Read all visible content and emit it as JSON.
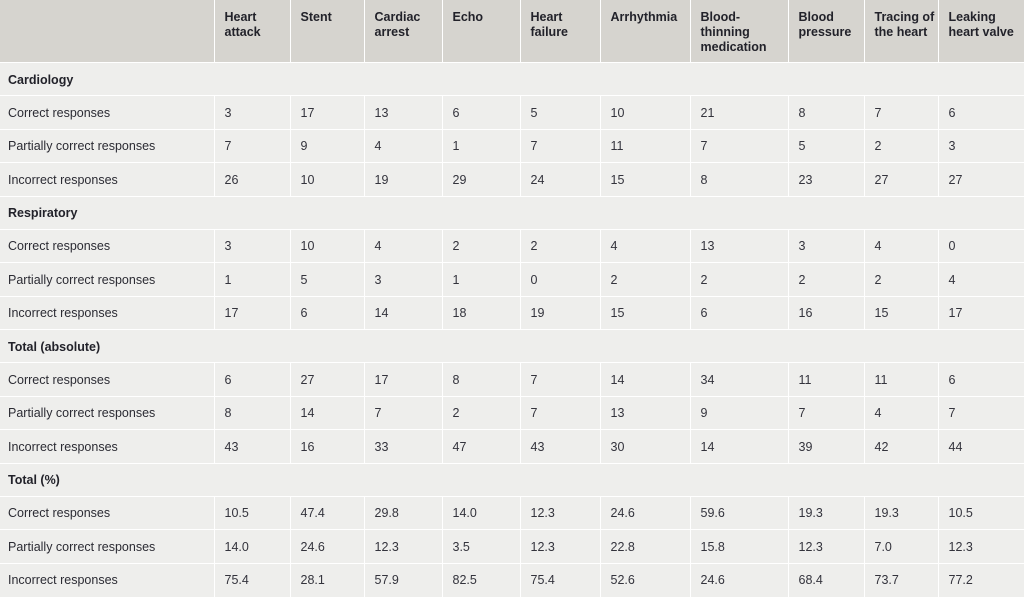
{
  "table": {
    "corner_label": "",
    "columns": [
      "Heart attack",
      "Stent",
      "Cardiac arrest",
      "Echo",
      "Heart failure",
      "Arrhythmia",
      "Blood-thinning medication",
      "Blood pressure",
      "Tracing of the heart",
      "Leaking heart valve"
    ],
    "sections": [
      {
        "title": "Cardiology",
        "rows": [
          {
            "label": "Correct responses",
            "values": [
              "3",
              "17",
              "13",
              "6",
              "5",
              "10",
              "21",
              "8",
              "7",
              "6"
            ]
          },
          {
            "label": "Partially correct responses",
            "values": [
              "7",
              "9",
              "4",
              "1",
              "7",
              "11",
              "7",
              "5",
              "2",
              "3"
            ]
          },
          {
            "label": "Incorrect responses",
            "values": [
              "26",
              "10",
              "19",
              "29",
              "24",
              "15",
              "8",
              "23",
              "27",
              "27"
            ]
          }
        ]
      },
      {
        "title": "Respiratory",
        "rows": [
          {
            "label": "Correct responses",
            "values": [
              "3",
              "10",
              "4",
              "2",
              "2",
              "4",
              "13",
              "3",
              "4",
              "0"
            ]
          },
          {
            "label": "Partially correct responses",
            "values": [
              "1",
              "5",
              "3",
              "1",
              "0",
              "2",
              "2",
              "2",
              "2",
              "4"
            ]
          },
          {
            "label": "Incorrect responses",
            "values": [
              "17",
              "6",
              "14",
              "18",
              "19",
              "15",
              "6",
              "16",
              "15",
              "17"
            ]
          }
        ]
      },
      {
        "title": "Total (absolute)",
        "rows": [
          {
            "label": "Correct responses",
            "values": [
              "6",
              "27",
              "17",
              "8",
              "7",
              "14",
              "34",
              "11",
              "11",
              "6"
            ]
          },
          {
            "label": "Partially correct responses",
            "values": [
              "8",
              "14",
              "7",
              "2",
              "7",
              "13",
              "9",
              "7",
              "4",
              "7"
            ]
          },
          {
            "label": "Incorrect responses",
            "values": [
              "43",
              "16",
              "33",
              "47",
              "43",
              "30",
              "14",
              "39",
              "42",
              "44"
            ]
          }
        ]
      },
      {
        "title": "Total (%)",
        "rows": [
          {
            "label": "Correct responses",
            "values": [
              "10.5",
              "47.4",
              "29.8",
              "14.0",
              "12.3",
              "24.6",
              "59.6",
              "19.3",
              "19.3",
              "10.5"
            ]
          },
          {
            "label": "Partially correct responses",
            "values": [
              "14.0",
              "24.6",
              "12.3",
              "3.5",
              "12.3",
              "22.8",
              "15.8",
              "12.3",
              "7.0",
              "12.3"
            ]
          },
          {
            "label": "Incorrect responses",
            "values": [
              "75.4",
              "28.1",
              "57.9",
              "82.5",
              "75.4",
              "52.6",
              "24.6",
              "68.4",
              "73.7",
              "77.2"
            ]
          }
        ]
      }
    ]
  },
  "colors": {
    "header_background": "#d6d4cf",
    "body_background": "#eeeeec",
    "grid_line": "#ffffff",
    "text": "#2b2b33"
  },
  "chart_data": {
    "type": "table",
    "title": "",
    "categories": [
      "Heart attack",
      "Stent",
      "Cardiac arrest",
      "Echo",
      "Heart failure",
      "Arrhythmia",
      "Blood-thinning medication",
      "Blood pressure",
      "Tracing of the heart",
      "Leaking heart valve"
    ],
    "series": [
      {
        "name": "Cardiology — Correct responses",
        "values": [
          3,
          17,
          13,
          6,
          5,
          10,
          21,
          8,
          7,
          6
        ]
      },
      {
        "name": "Cardiology — Partially correct responses",
        "values": [
          7,
          9,
          4,
          1,
          7,
          11,
          7,
          5,
          2,
          3
        ]
      },
      {
        "name": "Cardiology — Incorrect responses",
        "values": [
          26,
          10,
          19,
          29,
          24,
          15,
          8,
          23,
          27,
          27
        ]
      },
      {
        "name": "Respiratory — Correct responses",
        "values": [
          3,
          10,
          4,
          2,
          2,
          4,
          13,
          3,
          4,
          0
        ]
      },
      {
        "name": "Respiratory — Partially correct responses",
        "values": [
          1,
          5,
          3,
          1,
          0,
          2,
          2,
          2,
          2,
          4
        ]
      },
      {
        "name": "Respiratory — Incorrect responses",
        "values": [
          17,
          6,
          14,
          18,
          19,
          15,
          6,
          16,
          15,
          17
        ]
      },
      {
        "name": "Total (absolute) — Correct responses",
        "values": [
          6,
          27,
          17,
          8,
          7,
          14,
          34,
          11,
          11,
          6
        ]
      },
      {
        "name": "Total (absolute) — Partially correct responses",
        "values": [
          8,
          14,
          7,
          2,
          7,
          13,
          9,
          7,
          4,
          7
        ]
      },
      {
        "name": "Total (absolute) — Incorrect responses",
        "values": [
          43,
          16,
          33,
          47,
          43,
          30,
          14,
          39,
          42,
          44
        ]
      },
      {
        "name": "Total (%) — Correct responses",
        "values": [
          10.5,
          47.4,
          29.8,
          14.0,
          12.3,
          24.6,
          59.6,
          19.3,
          19.3,
          10.5
        ]
      },
      {
        "name": "Total (%) — Partially correct responses",
        "values": [
          14.0,
          24.6,
          12.3,
          3.5,
          12.3,
          22.8,
          15.8,
          12.3,
          7.0,
          12.3
        ]
      },
      {
        "name": "Total (%) — Incorrect responses",
        "values": [
          75.4,
          28.1,
          57.9,
          82.5,
          75.4,
          52.6,
          24.6,
          68.4,
          73.7,
          77.2
        ]
      }
    ],
    "xlabel": "",
    "ylabel": "",
    "grid": true,
    "legend_position": "none"
  }
}
